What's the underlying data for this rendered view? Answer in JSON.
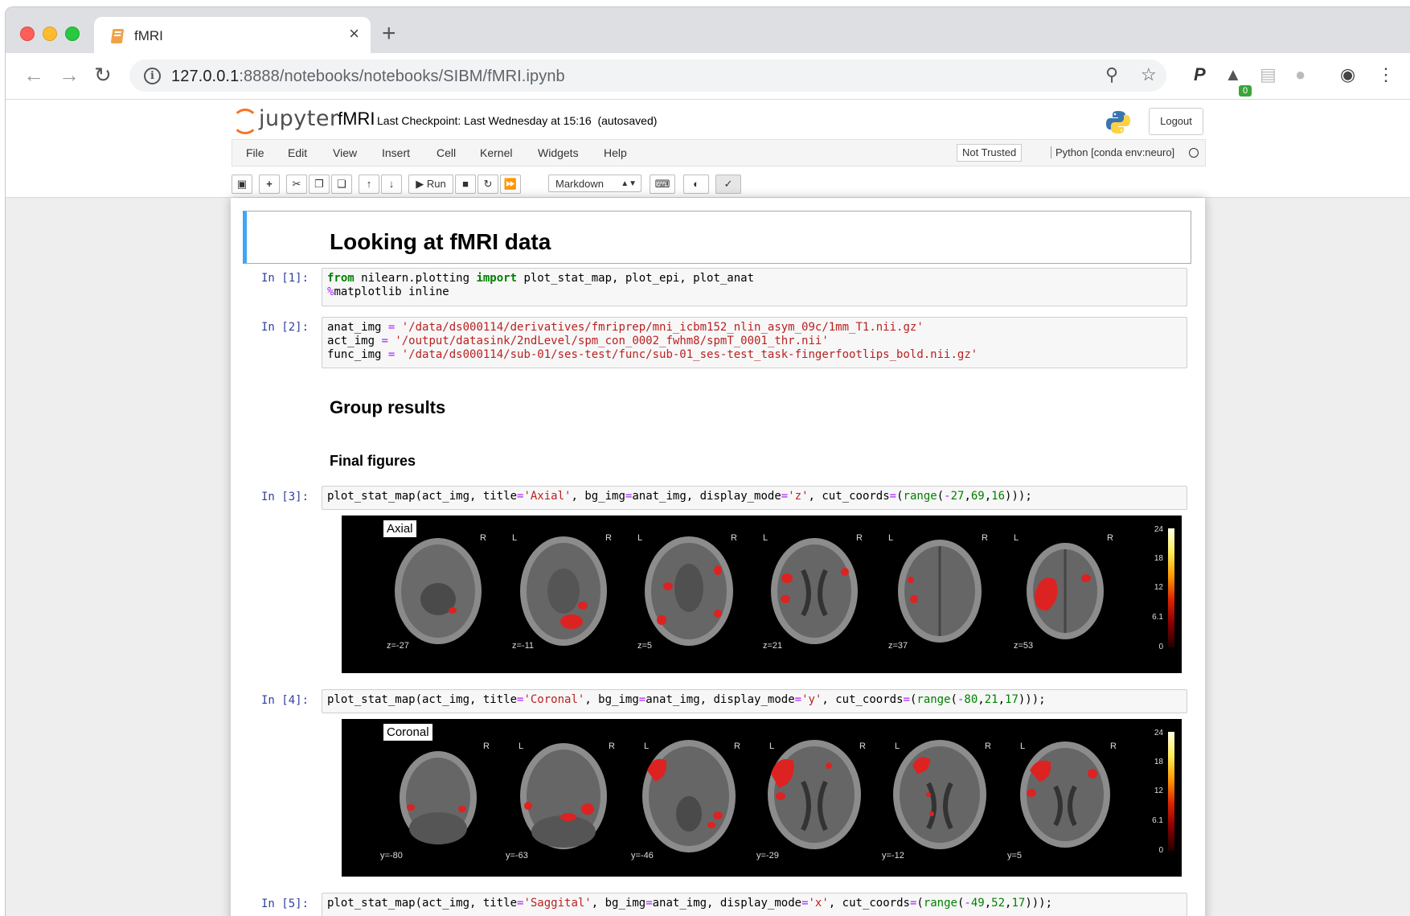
{
  "browser": {
    "tab_title": "fMRI",
    "tab_close": "×",
    "new_tab": "+",
    "url_host": "127.0.0.1",
    "url_path": ":8888/notebooks/notebooks/SIBM/fMRI.ipynb",
    "extension_badge": "0",
    "icons": [
      "back-icon",
      "forward-icon",
      "reload-icon",
      "info-icon",
      "zoom-icon",
      "star-icon",
      "profile-icon",
      "menu-icon"
    ]
  },
  "jupyter": {
    "logo_text": "jupyter",
    "notebook_name": "fMRI",
    "checkpoint": "Last Checkpoint: Last Wednesday at 15:16",
    "autosave": "(autosaved)",
    "logout": "Logout",
    "menu": [
      "File",
      "Edit",
      "View",
      "Insert",
      "Cell",
      "Kernel",
      "Widgets",
      "Help"
    ],
    "trust": "Not Trusted",
    "kernel": "Python [conda env:neuro]",
    "run_label": "Run",
    "cell_type": "Markdown"
  },
  "cells": {
    "title": "Looking at fMRI data",
    "p1": "In [1]:",
    "p2": "In [2]:",
    "p3": "In [3]:",
    "p4": "In [4]:",
    "p5": "In [5]:",
    "group": "Group results",
    "final": "Final figures"
  },
  "plots": {
    "axial": {
      "title": "Axial",
      "labels": [
        "z=-27",
        "z=-11",
        "z=5",
        "z=21",
        "z=37",
        "z=53"
      ]
    },
    "coronal": {
      "title": "Coronal",
      "labels": [
        "y=-80",
        "y=-63",
        "y=-46",
        "y=-29",
        "y=-12",
        "y=5"
      ]
    },
    "L": "L",
    "R": "R",
    "colorbar_ticks": [
      "24",
      "18",
      "12",
      "6.1",
      "0"
    ]
  },
  "colors": {
    "accent": "#42a5f5",
    "jupyter_orange": "#f37626",
    "prompt": "#303f9f"
  }
}
